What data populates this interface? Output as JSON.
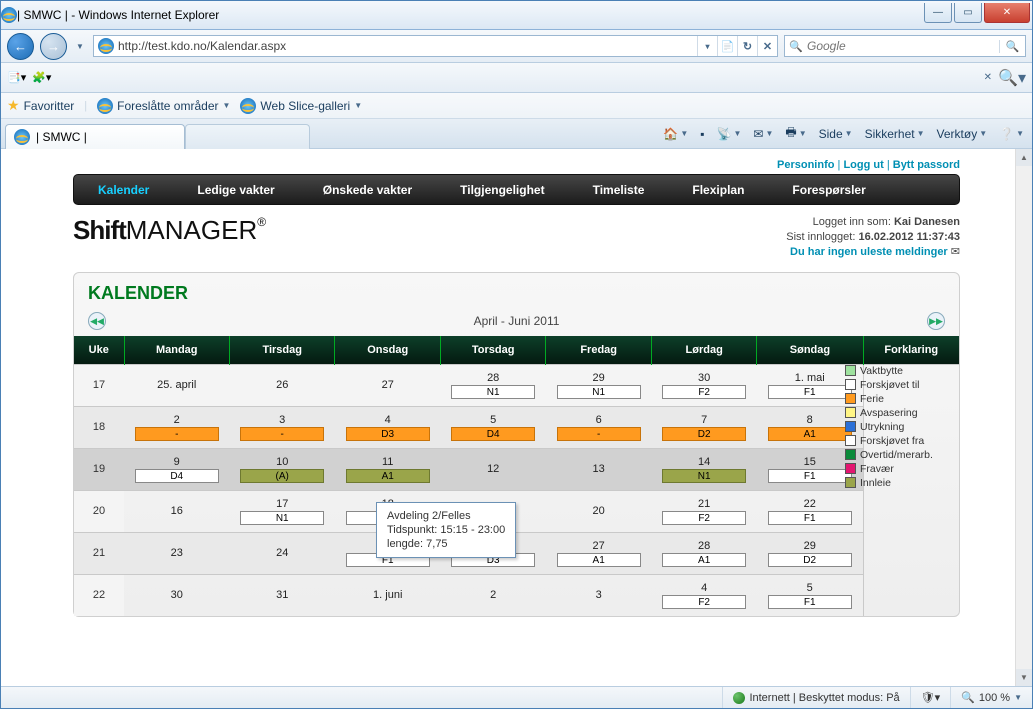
{
  "window": {
    "title": "| SMWC | - Windows Internet Explorer"
  },
  "addressbar": {
    "url": "http://test.kdo.no/Kalendar.aspx"
  },
  "searchbox": {
    "placeholder": "Google"
  },
  "favbar": {
    "favoritter": "Favoritter",
    "foreslatte": "Foreslåtte områder",
    "webslice": "Web Slice-galleri"
  },
  "tab": {
    "title": "| SMWC |"
  },
  "ietoolbar": {
    "side": "Side",
    "sikkerhet": "Sikkerhet",
    "verktoy": "Verktøy"
  },
  "toplinks": {
    "personinfo": "Personinfo",
    "loggut": "Logg ut",
    "byttpassord": "Bytt passord"
  },
  "mainnav": {
    "items": [
      "Kalender",
      "Ledige vakter",
      "Ønskede vakter",
      "Tilgjengelighet",
      "Timeliste",
      "Flexiplan",
      "Forespørsler"
    ]
  },
  "login": {
    "label": "Logget inn som:",
    "user": "Kai Danesen",
    "lastlabel": "Sist innlogget:",
    "lasttime": "16.02.2012 11:37:43",
    "msg": "Du har ingen uleste meldinger"
  },
  "calendar": {
    "heading": "KALENDER",
    "period": "April - Juni 2011",
    "headers": [
      "Uke",
      "Mandag",
      "Tirsdag",
      "Onsdag",
      "Torsdag",
      "Fredag",
      "Lørdag",
      "Søndag",
      "Forklaring"
    ],
    "rows": [
      {
        "wk": "17",
        "cells": [
          {
            "d": "25. april"
          },
          {
            "d": "26"
          },
          {
            "d": "27"
          },
          {
            "d": "28",
            "s": "N1",
            "c": ""
          },
          {
            "d": "29",
            "s": "N1",
            "c": ""
          },
          {
            "d": "30",
            "s": "F2",
            "c": ""
          },
          {
            "d": "1. mai",
            "s": "F1",
            "c": ""
          }
        ]
      },
      {
        "wk": "18",
        "alt": true,
        "cells": [
          {
            "d": "2",
            "s": "-",
            "c": "orange"
          },
          {
            "d": "3",
            "s": "-",
            "c": "orange"
          },
          {
            "d": "4",
            "s": "D3",
            "c": "orange"
          },
          {
            "d": "5",
            "s": "D4",
            "c": "orange"
          },
          {
            "d": "6",
            "s": "-",
            "c": "orange"
          },
          {
            "d": "7",
            "s": "D2",
            "c": "orange"
          },
          {
            "d": "8",
            "s": "A1",
            "c": "orange"
          }
        ]
      },
      {
        "wk": "19",
        "sel": true,
        "cells": [
          {
            "d": "9",
            "s": "D4",
            "c": ""
          },
          {
            "d": "10",
            "s": "(A)",
            "c": "olive"
          },
          {
            "d": "11",
            "s": "A1",
            "c": "olive"
          },
          {
            "d": "12"
          },
          {
            "d": "13"
          },
          {
            "d": "14",
            "s": "N1",
            "c": "olive"
          },
          {
            "d": "15",
            "s": "F1",
            "c": ""
          }
        ]
      },
      {
        "wk": "20",
        "cells": [
          {
            "d": "16"
          },
          {
            "d": "17",
            "s": "N1",
            "c": ""
          },
          {
            "d": "18",
            "s": "-",
            "c": ""
          },
          {
            "d": "19"
          },
          {
            "d": "20"
          },
          {
            "d": "21",
            "s": "F2",
            "c": ""
          },
          {
            "d": "22",
            "s": "F1",
            "c": ""
          }
        ]
      },
      {
        "wk": "21",
        "alt": true,
        "cells": [
          {
            "d": "23"
          },
          {
            "d": "24"
          },
          {
            "d": "25",
            "s": "F1",
            "c": ""
          },
          {
            "d": "26",
            "s": "D3",
            "c": ""
          },
          {
            "d": "27",
            "s": "A1",
            "c": ""
          },
          {
            "d": "28",
            "s": "A1",
            "c": ""
          },
          {
            "d": "29",
            "s": "D2",
            "c": ""
          }
        ]
      },
      {
        "wk": "22",
        "cells": [
          {
            "d": "30"
          },
          {
            "d": "31"
          },
          {
            "d": "1. juni"
          },
          {
            "d": "2"
          },
          {
            "d": "3"
          },
          {
            "d": "4",
            "s": "F2",
            "c": ""
          },
          {
            "d": "5",
            "s": "F1",
            "c": ""
          }
        ]
      }
    ],
    "legend": [
      {
        "c": "c-vaktbytte",
        "t": "Vaktbytte"
      },
      {
        "c": "c-forskj",
        "t": "Forskjøvet til"
      },
      {
        "c": "c-ferie",
        "t": "Ferie"
      },
      {
        "c": "c-avsp",
        "t": "Avspasering"
      },
      {
        "c": "c-utryk",
        "t": "Utrykning"
      },
      {
        "c": "c-forfra",
        "t": "Forskjøvet fra"
      },
      {
        "c": "c-overtid",
        "t": "Overtid/merarb."
      },
      {
        "c": "c-fravaer",
        "t": "Fravær"
      },
      {
        "c": "c-innleie",
        "t": "Innleie"
      }
    ]
  },
  "tooltip": {
    "line1": "Avdeling 2/Felles",
    "line2": "Tidspunkt: 15:15 - 23:00",
    "line3": "lengde: 7,75"
  },
  "status": {
    "zone": "Internett | Beskyttet modus: På",
    "zoom": "100 %"
  }
}
